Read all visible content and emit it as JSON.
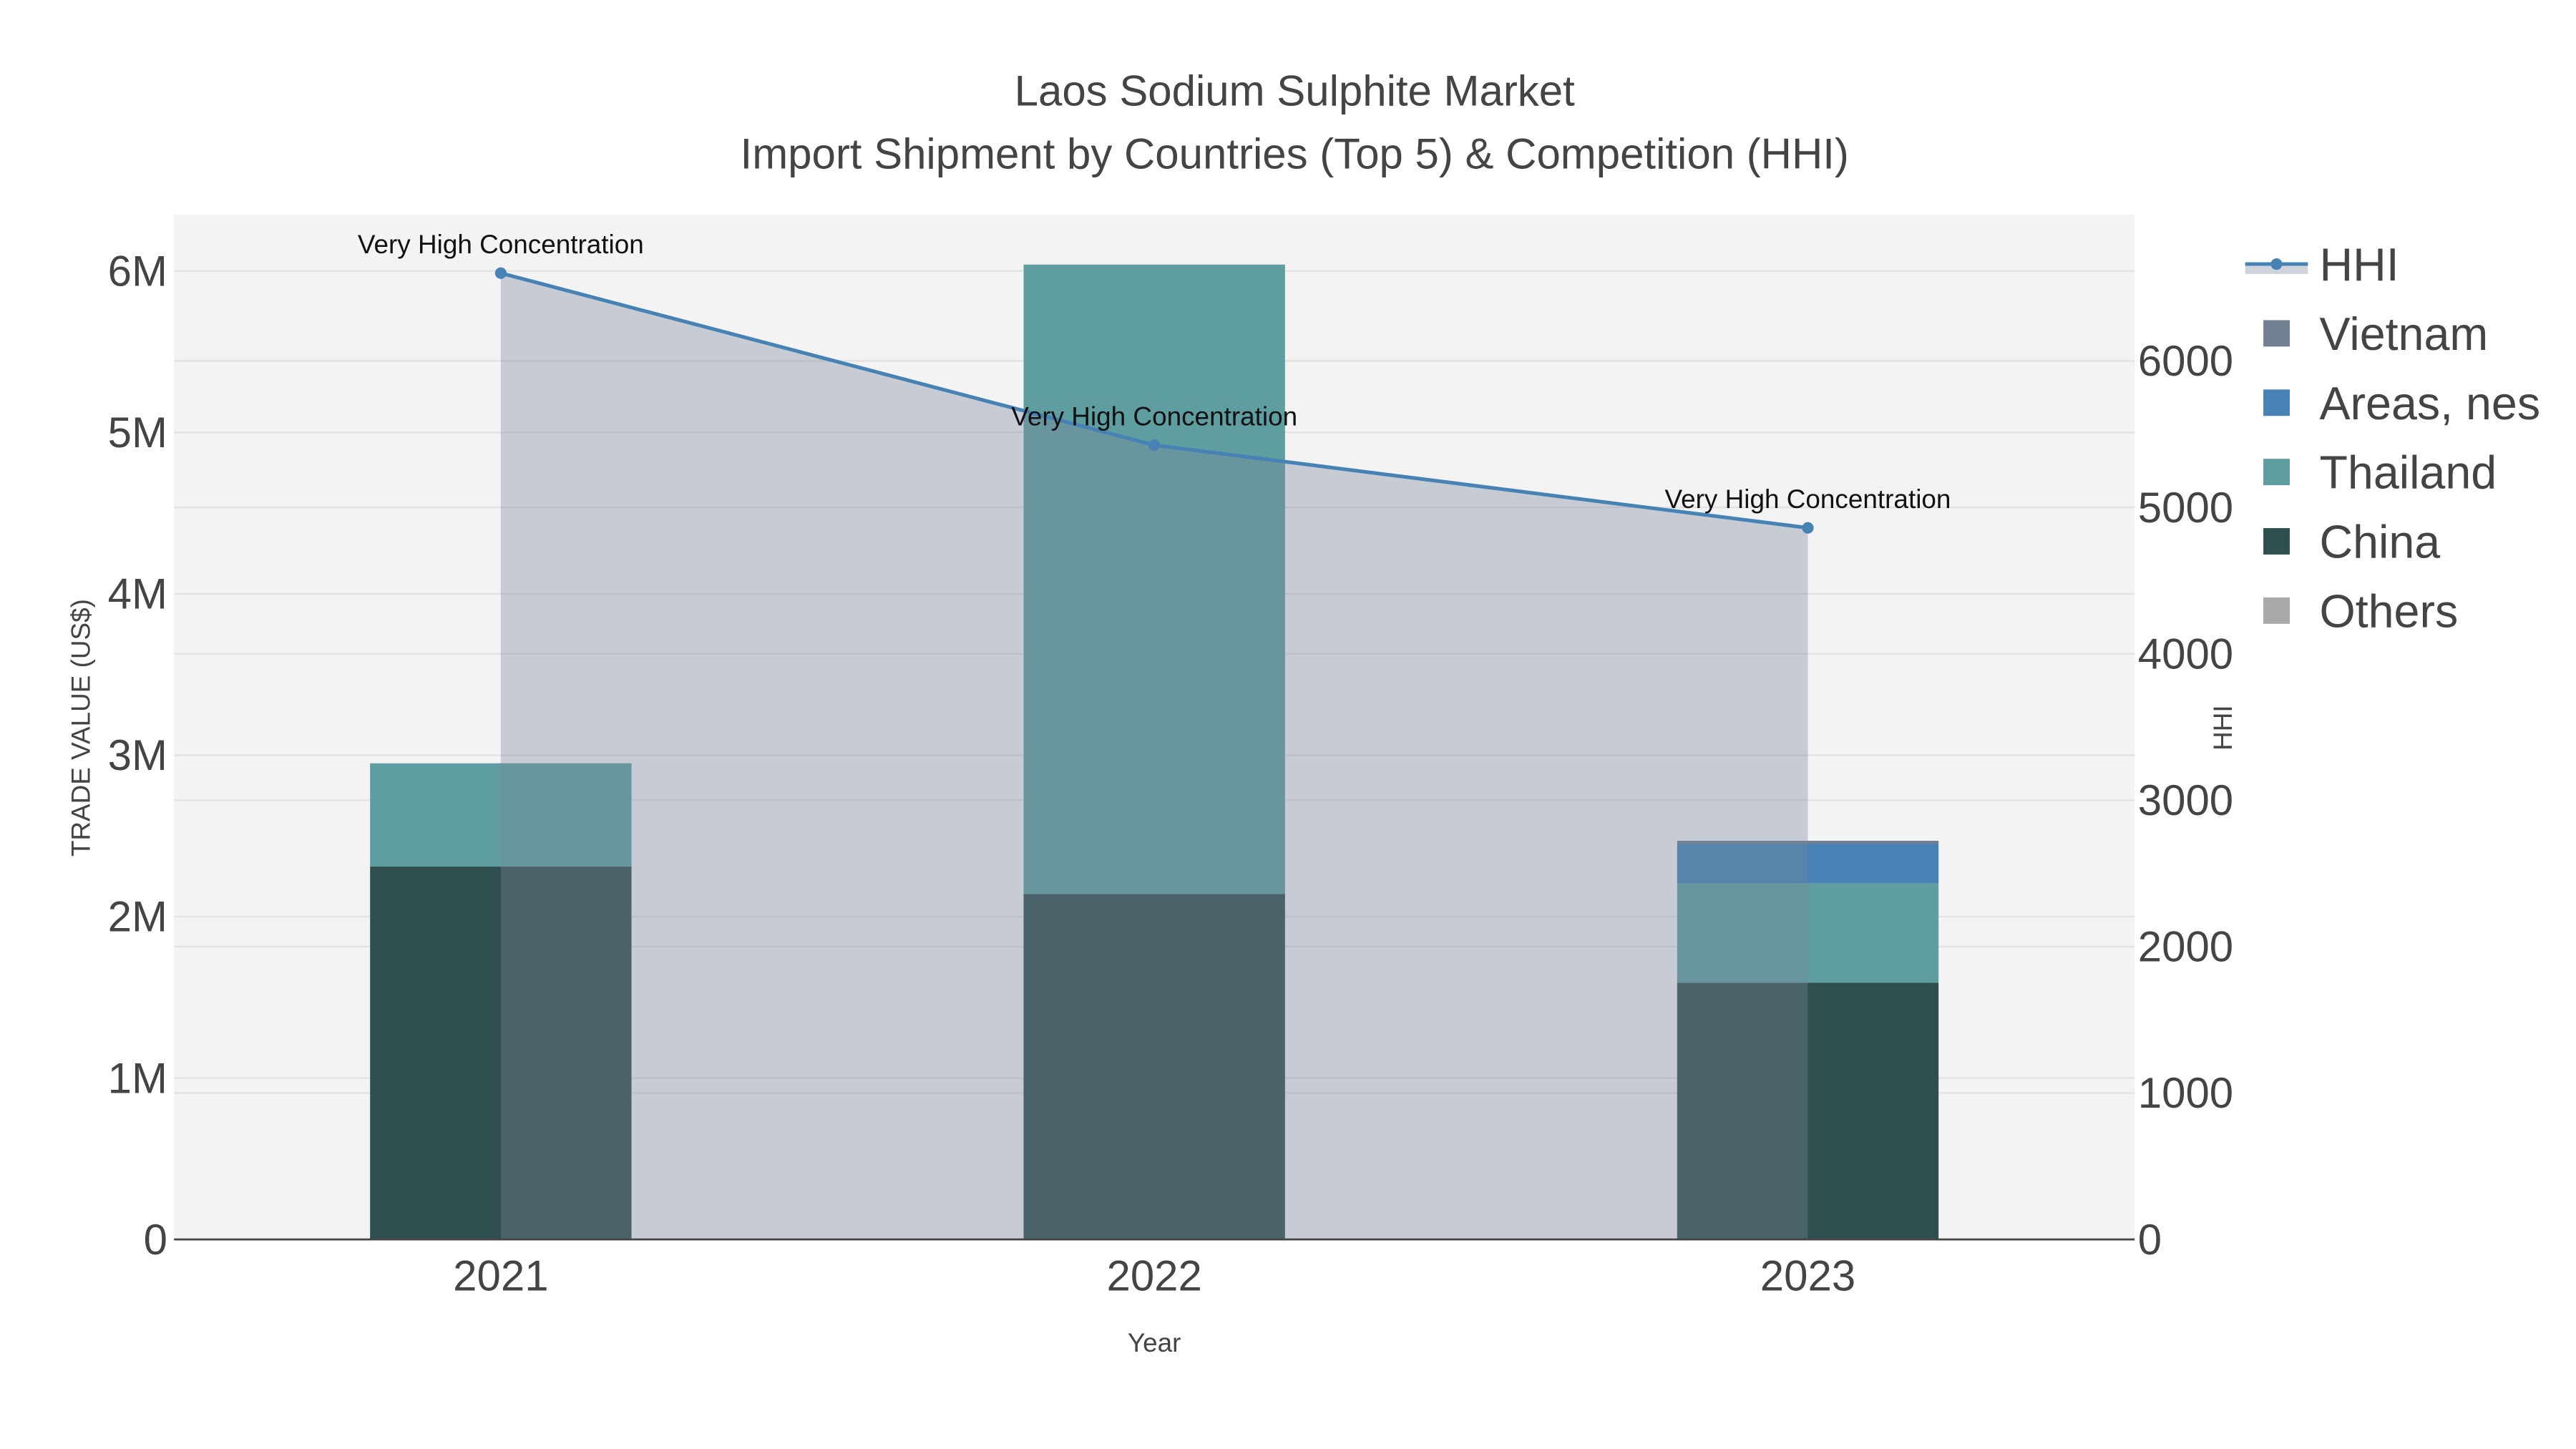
{
  "chart_data": {
    "type": "bar",
    "title": "Laos Sodium Sulphite Market",
    "subtitle": "Import Shipment by Countries (Top 5) & Competition (HHI)",
    "xlabel": "Year",
    "ylabel": "TRADE VALUE (US$)",
    "y2label": "HHI",
    "categories": [
      "2021",
      "2022",
      "2023"
    ],
    "ylim": [
      0,
      6350000
    ],
    "y2lim": [
      0,
      7000
    ],
    "yticks": [
      {
        "v": 0,
        "label": "0"
      },
      {
        "v": 1000000,
        "label": "1M"
      },
      {
        "v": 2000000,
        "label": "2M"
      },
      {
        "v": 3000000,
        "label": "3M"
      },
      {
        "v": 4000000,
        "label": "4M"
      },
      {
        "v": 5000000,
        "label": "5M"
      },
      {
        "v": 6000000,
        "label": "6M"
      }
    ],
    "y2ticks": [
      {
        "v": 0,
        "label": "0"
      },
      {
        "v": 1000,
        "label": "1000"
      },
      {
        "v": 2000,
        "label": "2000"
      },
      {
        "v": 3000,
        "label": "3000"
      },
      {
        "v": 4000,
        "label": "4000"
      },
      {
        "v": 5000,
        "label": "5000"
      },
      {
        "v": 6000,
        "label": "6000"
      }
    ],
    "series": [
      {
        "name": "China",
        "color": "#2f4f4f",
        "values": [
          2310000,
          2140000,
          1590000
        ]
      },
      {
        "name": "Thailand",
        "color": "#5f9ea0",
        "values": [
          640000,
          3900000,
          615000
        ]
      },
      {
        "name": "Areas, nes",
        "color": "#4682b4",
        "values": [
          0,
          0,
          245000
        ]
      },
      {
        "name": "Vietnam",
        "color": "#708090",
        "values": [
          0,
          0,
          20000
        ]
      },
      {
        "name": "Others",
        "color": "#a9a9a9",
        "values": [
          0,
          0,
          0
        ]
      }
    ],
    "hhi": {
      "name": "HHI",
      "color": "#4682b4",
      "values": [
        6600,
        5425,
        4860
      ],
      "labels": [
        "Very High Concentration",
        "Very High Concentration",
        "Very High Concentration"
      ]
    },
    "legend": [
      "HHI",
      "Vietnam",
      "Areas, nes",
      "Thailand",
      "China",
      "Others"
    ],
    "legend_placement": "top-right",
    "grid": true
  }
}
